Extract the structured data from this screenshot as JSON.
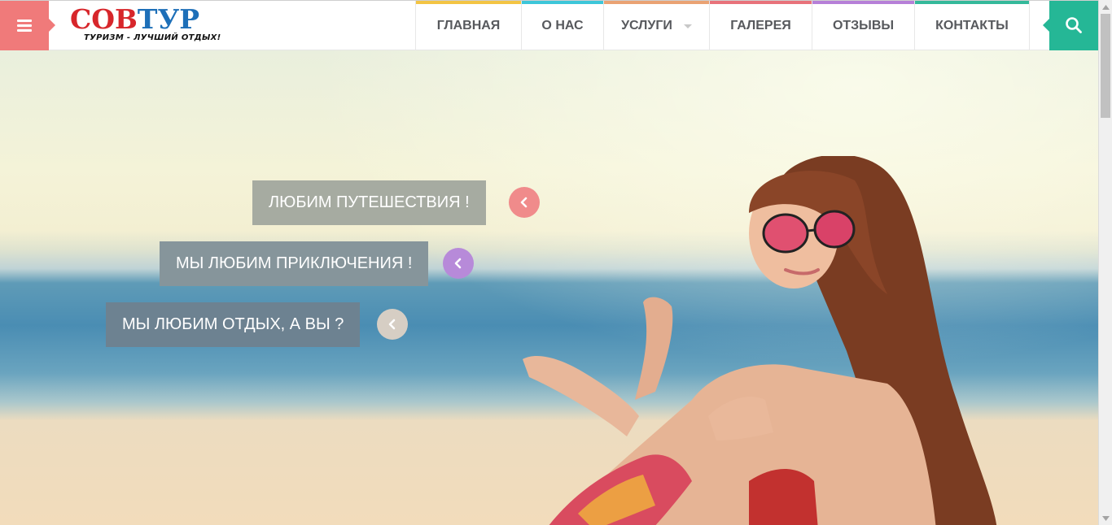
{
  "header": {
    "logo": {
      "word_red": "СОВ",
      "word_blue": "ТУР",
      "tagline": "ТУРИЗМ - ЛУЧШИЙ ОТДЫХ!"
    },
    "menu_icon": "hamburger-icon",
    "search_icon": "search-icon",
    "colors": {
      "menu_button": "#f07a7a",
      "search_button": "#25b796"
    }
  },
  "nav": {
    "items": [
      {
        "label": "ГЛАВНАЯ",
        "color": "#f3c443"
      },
      {
        "label": "О НАС",
        "color": "#3dc6d9"
      },
      {
        "label": "УСЛУГИ",
        "color": "#eaa273",
        "has_dropdown": true
      },
      {
        "label": "ГАЛЕРЕЯ",
        "color": "#e8727a"
      },
      {
        "label": "ОТЗЫВЫ",
        "color": "#b67fd8"
      },
      {
        "label": "КОНТАКТЫ",
        "color": "#34b99a"
      }
    ]
  },
  "hero": {
    "slides": [
      {
        "label": "ЛЮБИМ ПУТЕШЕСТВИЯ !",
        "label_bg": "#a6aba1",
        "arrow_color": "#f08b8b"
      },
      {
        "label": "МЫ ЛЮБИМ ПРИКЛЮЧЕНИЯ !",
        "label_bg": "#86959b",
        "arrow_color": "#b78ad9"
      },
      {
        "label": "МЫ ЛЮБИМ ОТДЫХ, А ВЫ ?",
        "label_bg": "#6d8291",
        "arrow_color": "#d6cec4"
      }
    ],
    "arrow_icon": "chevron-left-icon"
  }
}
